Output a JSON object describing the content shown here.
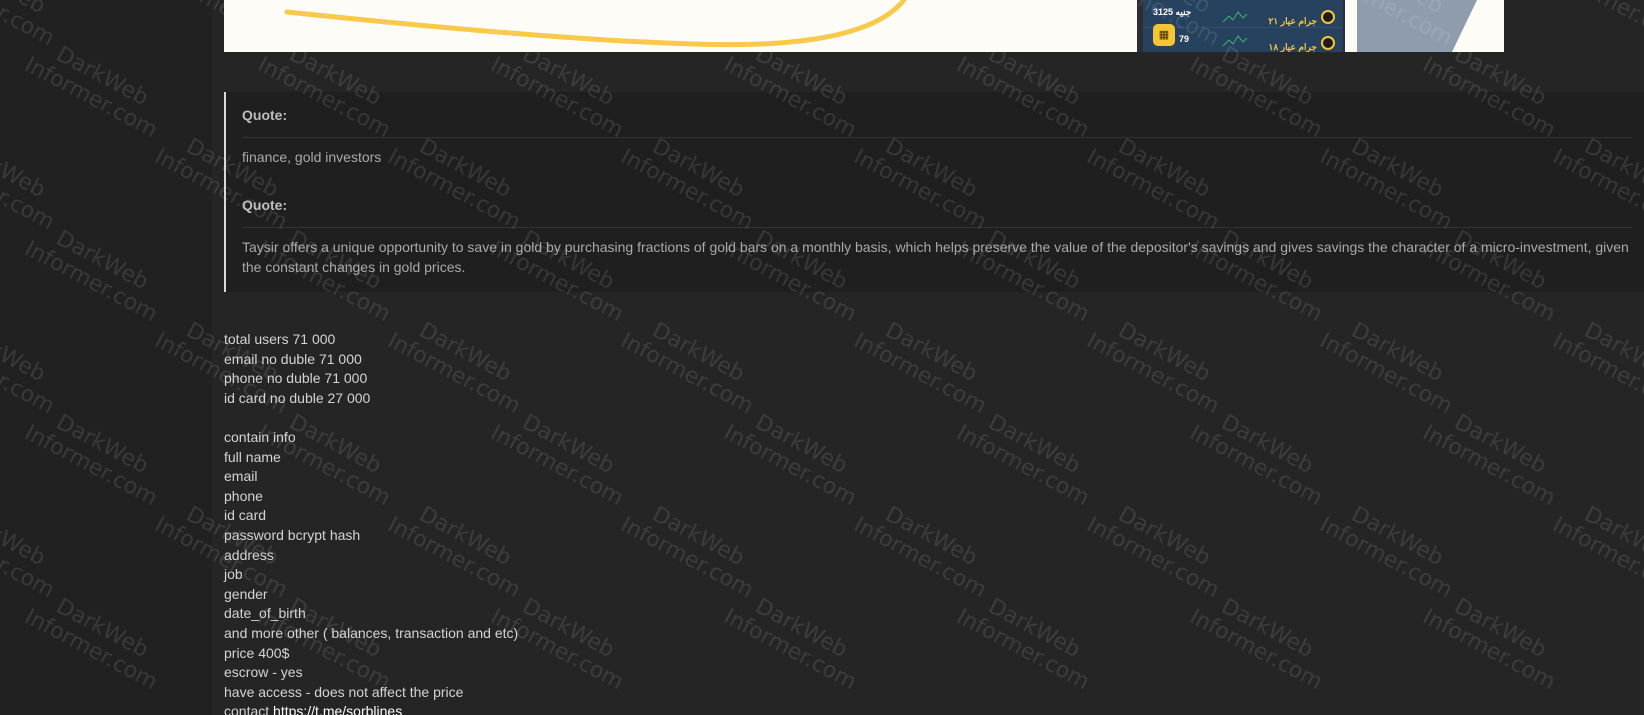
{
  "image_strip": {
    "phone": {
      "price_value": "3125",
      "price_unit": "جنيه",
      "second_value": "79",
      "row1_label": "جرام عيار ٢١",
      "row2_label": "جرام عيار ١٨"
    },
    "colors": {
      "curve": "#f8c94a",
      "phone_screen": "#27425e",
      "gold_accent": "#f6c534"
    }
  },
  "quotes": [
    {
      "label": "Quote:",
      "text": "finance, gold investors"
    },
    {
      "label": "Quote:",
      "text": "Taysir offers a unique opportunity to save in gold by purchasing fractions of gold bars on a monthly basis, which helps preserve the value of the depositor's savings and gives savings the character of a micro-investment, given the constant changes in gold prices."
    }
  ],
  "stats": [
    "total users 71 000",
    "email no duble 71 000",
    "phone no duble 71 000",
    "id card no duble 27 000"
  ],
  "contents": [
    "contain info",
    "full name",
    "email",
    "phone",
    "id card",
    "password bcrypt hash",
    "address",
    "job",
    "gender",
    "date_of_birth",
    "and more other ( balances, transaction and etc)",
    "price 400$",
    "escrow - yes",
    "have access - does not affect the price"
  ],
  "contact": {
    "prefix": "contact ",
    "link_text": "https://t.me/sorblines"
  },
  "watermark": {
    "line1": "DarkWeb",
    "line2": "Informer.com"
  }
}
